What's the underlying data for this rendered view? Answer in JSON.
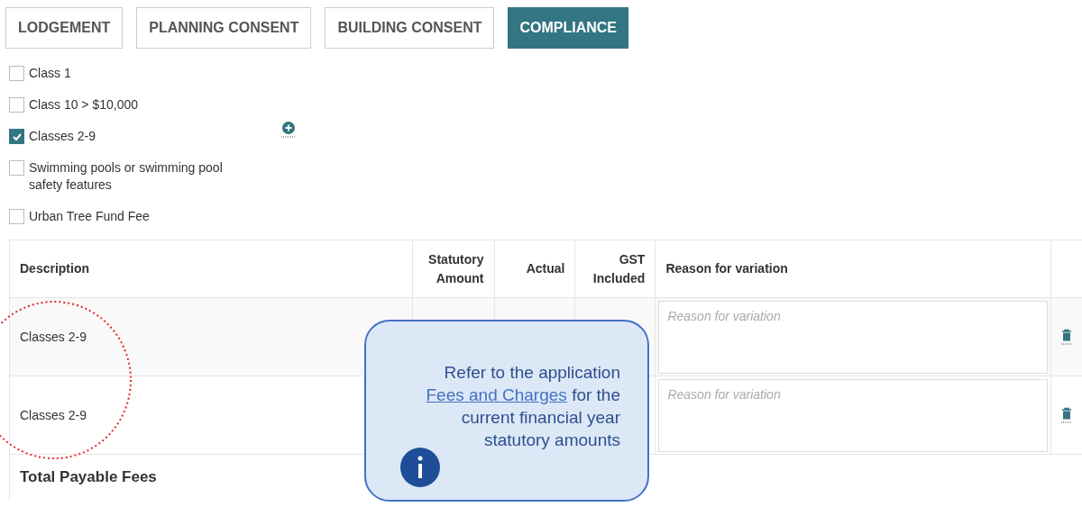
{
  "tabs": [
    {
      "label": "LODGEMENT",
      "selected": false
    },
    {
      "label": "PLANNING CONSENT",
      "selected": false
    },
    {
      "label": "BUILDING CONSENT",
      "selected": false
    },
    {
      "label": "COMPLIANCE",
      "selected": true
    }
  ],
  "fee_options": [
    {
      "label": "Class 1",
      "checked": false
    },
    {
      "label": "Class 10 > $10,000",
      "checked": false
    },
    {
      "label": "Classes 2-9",
      "checked": true
    },
    {
      "label": "Swimming pools or swimming pool safety features",
      "checked": false
    },
    {
      "label": "Urban Tree Fund Fee",
      "checked": false
    }
  ],
  "table": {
    "columns": [
      "Description",
      "Statutory Amount",
      "Actual",
      "GST Included",
      "Reason for variation"
    ],
    "rows": [
      {
        "description": "Classes 2-9",
        "reason_placeholder": "Reason for variation"
      },
      {
        "description": "Classes 2-9",
        "reason_placeholder": "Reason for variation"
      }
    ],
    "total_label": "Total Payable Fees"
  },
  "callout": {
    "text_before": "Refer to the application",
    "link": "Fees and Charges",
    "text_after": "for the current financial year statutory amounts"
  }
}
